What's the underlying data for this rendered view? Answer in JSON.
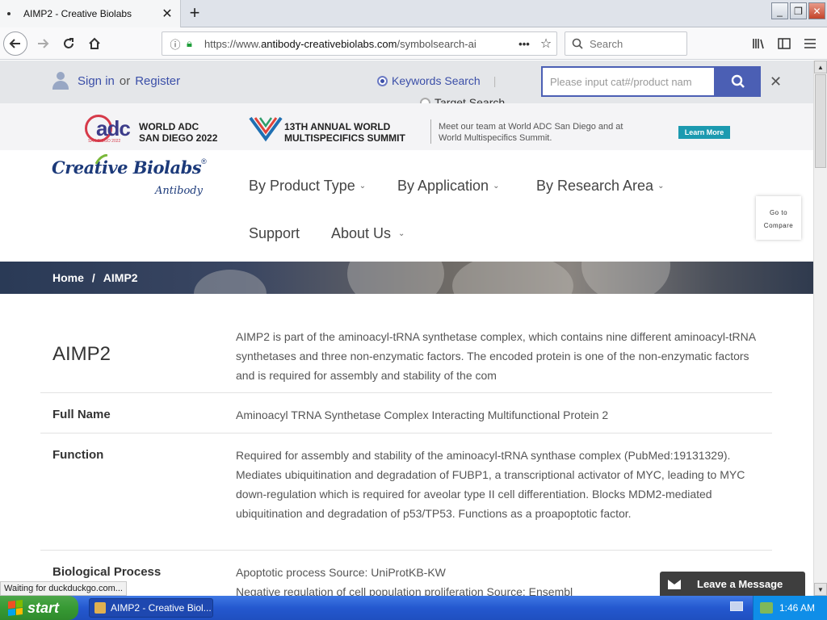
{
  "browser": {
    "tab_title": "AIMP2 - Creative Biolabs",
    "tab_close": "✕",
    "new_tab": "+",
    "url_prefix": "https://www.",
    "url_domain": "antibody-creativebiolabs.com",
    "url_path": "/symbolsearch-ai",
    "search_placeholder": "Search",
    "window_buttons": [
      "_",
      "❐",
      "✕"
    ]
  },
  "topbar": {
    "sign_in": "Sign in",
    "or": "or",
    "register": "Register",
    "keywords_search": "Keywords Search",
    "separator": "|",
    "target_search": "Target Search",
    "search_placeholder": "Please input cat#/product nam",
    "close": "✕"
  },
  "banner": {
    "adc_logo_text": "adc",
    "adc_logo_sub": "SAN DIEGO 2022",
    "adc_title_1": "WORLD ADC",
    "adc_title_2": "SAN DIEGO 2022",
    "summit_title_1": "13TH ANNUAL WORLD",
    "summit_title_2": "MULTISPECIFICS SUMMIT",
    "text_1": "Meet our team at World ADC San Diego and at",
    "text_2": "World Multispecifics Summit.",
    "learn_more": "Learn More"
  },
  "header": {
    "logo_brand": "Creative Biolabs",
    "logo_reg": "®",
    "logo_tag": "Antibody",
    "menu": [
      "By Product Type",
      "By Application",
      "By Research Area",
      "Support",
      "About Us"
    ],
    "compare_1": "Go to",
    "compare_2": "Compare"
  },
  "breadcrumb": {
    "home": "Home",
    "sep": "/",
    "current": "AIMP2"
  },
  "content": {
    "title": "AIMP2",
    "summary": "AIMP2 is part of the aminoacyl-tRNA synthetase complex, which contains nine different aminoacyl-tRNA synthetases and three non-enzymatic factors. The encoded protein is one of the non-enzymatic factors and is required for assembly and stability of the com",
    "rows": [
      {
        "label": "Full Name",
        "value": "Aminoacyl TRNA Synthetase Complex Interacting Multifunctional Protein 2"
      },
      {
        "label": "Function",
        "value": "Required for assembly and stability of the aminoacyl-tRNA synthase complex (PubMed:19131329). Mediates ubiquitination and degradation of FUBP1, a transcriptional activator of MYC, leading to MYC down-regulation which is required for aveolar type II cell differentiation. Blocks MDM2-mediated ubiquitination and degradation of p53/TP53. Functions as a proapoptotic factor."
      },
      {
        "label": "Biological Process",
        "value_1": "Apoptotic process Source: UniProtKB-KW",
        "value_2": "Negative regulation of cell population proliferation Source: Ensembl"
      }
    ]
  },
  "leave_message": "Leave a Message",
  "status_text": "Waiting for duckduckgo.com...",
  "taskbar": {
    "start": "start",
    "task": "AIMP2 - Creative Biol...",
    "time": "1:46 AM"
  },
  "colors": {
    "accent": "#4b5fb4",
    "link": "#3b4fa8",
    "learn_more": "#1c9ab0"
  }
}
